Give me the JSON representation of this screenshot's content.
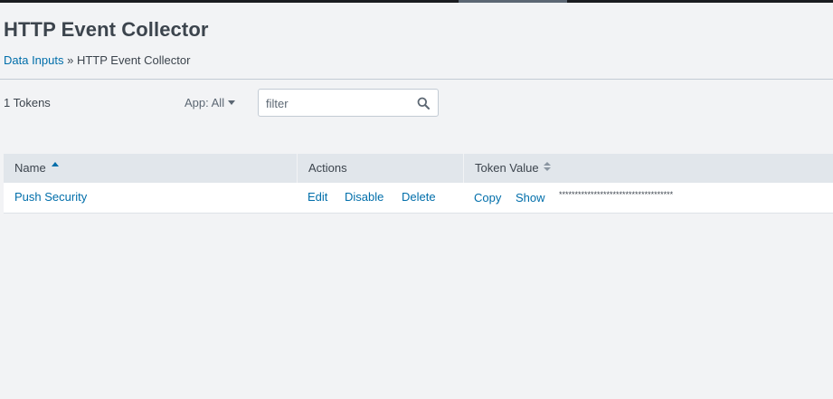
{
  "page": {
    "title": "HTTP Event Collector"
  },
  "breadcrumb": {
    "parent": "Data Inputs",
    "separator": " » ",
    "current": "HTTP Event Collector"
  },
  "toolbar": {
    "token_count": "1 Tokens",
    "app_filter_label": "App: All",
    "search_placeholder": "filter"
  },
  "table": {
    "columns": [
      {
        "label": "Name",
        "sort": "ascending"
      },
      {
        "label": "Actions",
        "sort": "none"
      },
      {
        "label": "Token Value",
        "sort": "sortable"
      }
    ],
    "rows": [
      {
        "name": "Push Security",
        "actions": [
          "Edit",
          "Disable",
          "Delete"
        ],
        "token_actions": [
          "Copy",
          "Show"
        ],
        "token_value": "************************************"
      }
    ]
  },
  "colors": {
    "link": "#006eaa",
    "text": "#3c444d",
    "background": "#f2f3f5",
    "header_bg": "#e1e6eb"
  },
  "icons": {
    "search": "search-icon",
    "app_dropdown": "caret-down-icon",
    "name_sort": "sort-ascending-icon",
    "token_sort": "sort-both-icon"
  }
}
